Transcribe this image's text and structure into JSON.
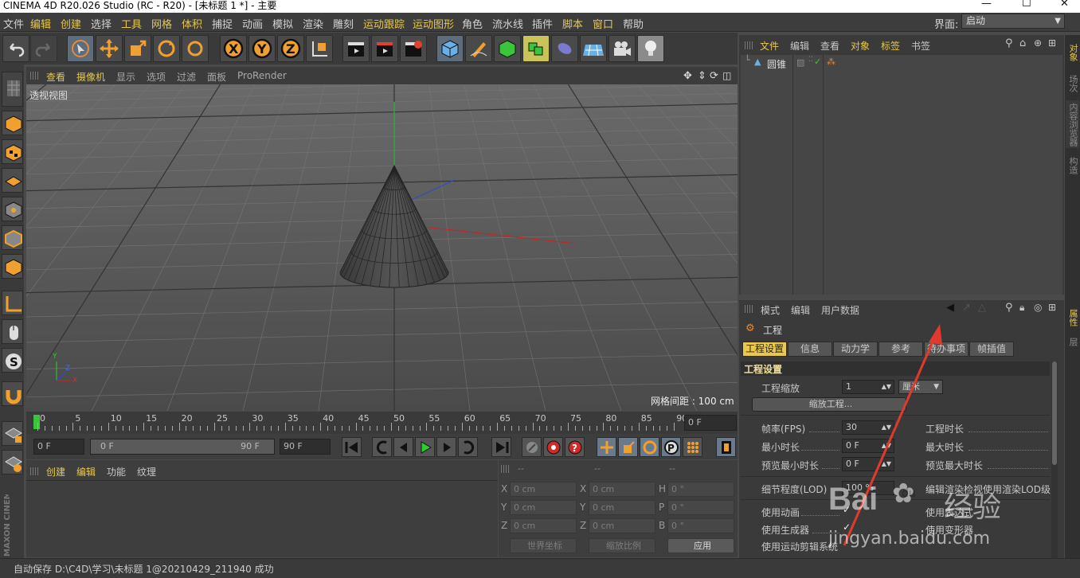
{
  "window": {
    "title": "CINEMA 4D R20.026 Studio (RC - R20) - [未标题 1 *] - 主要",
    "minimize": "—",
    "maximize": "☐",
    "close": "✕"
  },
  "menu": {
    "items": [
      "文件",
      "编辑",
      "创建",
      "选择",
      "工具",
      "网格",
      "体积",
      "捕捉",
      "动画",
      "模拟",
      "渲染",
      "雕刻",
      "运动跟踪",
      "运动图形",
      "角色",
      "流水线",
      "插件",
      "脚本",
      "窗口",
      "帮助"
    ],
    "layout_label": "界面:",
    "layout_value": "启动"
  },
  "viewport": {
    "menu": [
      "查看",
      "摄像机",
      "显示",
      "选项",
      "过滤",
      "面板",
      "ProRender"
    ],
    "view_name": "透视视图",
    "grid_spacing": "网格间距 : 100 cm",
    "axis": {
      "x": "X",
      "y": "Y",
      "z": "Z"
    }
  },
  "timeline": {
    "ticks": [
      "0",
      "5",
      "10",
      "15",
      "20",
      "25",
      "30",
      "35",
      "40",
      "45",
      "50",
      "55",
      "60",
      "65",
      "70",
      "75",
      "80",
      "85",
      "90"
    ],
    "current_frame": "0 F"
  },
  "playback": {
    "start_field": "0 F",
    "range_start": "0 F",
    "range_end": "90 F",
    "end_field": "90 F"
  },
  "material_manager": {
    "menu": [
      "创建",
      "编辑",
      "功能",
      "纹理"
    ]
  },
  "coordinates": {
    "headers": [
      "--",
      "--",
      "--"
    ],
    "rows": [
      {
        "a": "X",
        "av": "0 cm",
        "b": "X",
        "bv": "0 cm",
        "c": "H",
        "cv": "0 °"
      },
      {
        "a": "Y",
        "av": "0 cm",
        "b": "Y",
        "bv": "0 cm",
        "c": "P",
        "cv": "0 °"
      },
      {
        "a": "Z",
        "av": "0 cm",
        "b": "Z",
        "bv": "0 cm",
        "c": "B",
        "cv": "0 °"
      }
    ],
    "world_coord": "世界坐标",
    "scale_mode": "缩放比例",
    "apply": "应用"
  },
  "object_manager": {
    "menu": [
      "文件",
      "编辑",
      "查看",
      "对象",
      "标签",
      "书签"
    ],
    "objects": [
      {
        "name": "圆锥"
      }
    ]
  },
  "attribute_manager": {
    "menu": [
      "模式",
      "编辑",
      "用户数据"
    ],
    "title": "工程",
    "tabs": [
      "工程设置",
      "信息",
      "动力学",
      "参考",
      "待办事项",
      "帧插值"
    ],
    "section": "工程设置",
    "fields": {
      "project_scale_label": "工程缩放",
      "project_scale_value": "1",
      "project_scale_unit": "厘米",
      "scale_project_button": "缩放工程...",
      "fps_label": "帧率(FPS)",
      "fps_value": "30",
      "project_time_label": "工程时长",
      "min_time_label": "最小时长",
      "min_time_value": "0 F",
      "max_time_label": "最大时长",
      "preview_min_label": "预览最小时长",
      "preview_min_value": "0 F",
      "preview_max_label": "预览最大时长",
      "lod_label": "细节程度(LOD)",
      "lod_value": "100 %",
      "lod_render_label": "编辑渲染检视使用渲染LOD级",
      "use_anim_label": "使用动画",
      "use_expr_label": "使用表达式",
      "use_gen_label": "使用生成器",
      "use_deform_label": "使用变形器",
      "use_motion_label": "使用运动剪辑系统"
    }
  },
  "right_tabs": [
    "对象",
    "场次",
    "内容浏览器",
    "构造",
    "属性",
    "层"
  ],
  "status": "自动保存 D:\\C4D\\学习\\未标题 1@20210429_211940 成功",
  "watermark": {
    "brand": "Bai",
    "paw": "du",
    "cn": "经验",
    "url": "jingyan.baidu.com"
  },
  "brand_side": "MAXON CINEMA 4D",
  "colors": {
    "accent": "#e8c84a",
    "arrow": "#e03a2e",
    "bg": "#4a4a4a"
  }
}
